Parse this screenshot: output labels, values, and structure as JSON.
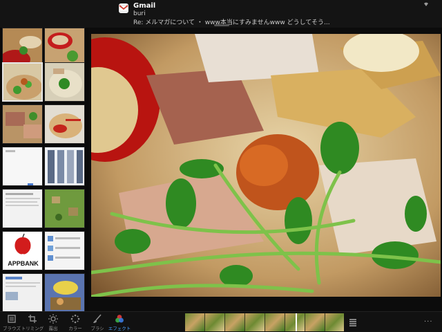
{
  "notification": {
    "app_name": "Gmail",
    "sender": "buri",
    "message": "Re: メルマガについて ・ www本当にすみませんwww どうしてそう...",
    "app_icon": "gmail-envelope-icon"
  },
  "sidebar": {
    "selected_index": 2,
    "thumbs": [
      {
        "kind": "ramen-bowl"
      },
      {
        "kind": "ramen-spoon"
      },
      {
        "kind": "ramen-close"
      },
      {
        "kind": "ramen-green"
      },
      {
        "kind": "ramen-meat"
      },
      {
        "kind": "soup-spoon"
      },
      {
        "kind": "white-page"
      },
      {
        "kind": "ui-grid"
      },
      {
        "kind": "document"
      },
      {
        "kind": "game-map"
      },
      {
        "kind": "appbank-logo",
        "logo_text": "APPBANK"
      },
      {
        "kind": "list-page"
      },
      {
        "kind": "article-page"
      },
      {
        "kind": "game-art"
      }
    ]
  },
  "toolbar": {
    "tools": [
      {
        "label": "ブラウズ",
        "icon": "browse-icon"
      },
      {
        "label": "トリミング",
        "icon": "crop-icon"
      },
      {
        "label": "露出",
        "icon": "exposure-icon"
      },
      {
        "label": "カラー",
        "icon": "color-icon"
      },
      {
        "label": "ブラシ",
        "icon": "brush-icon"
      },
      {
        "label": "エフェクト",
        "icon": "effects-icon"
      }
    ],
    "active_tool": "エフェクト",
    "more_label": "···"
  },
  "colors": {
    "accent": "#4aa3ff",
    "toolbar_bg": "#111111"
  }
}
